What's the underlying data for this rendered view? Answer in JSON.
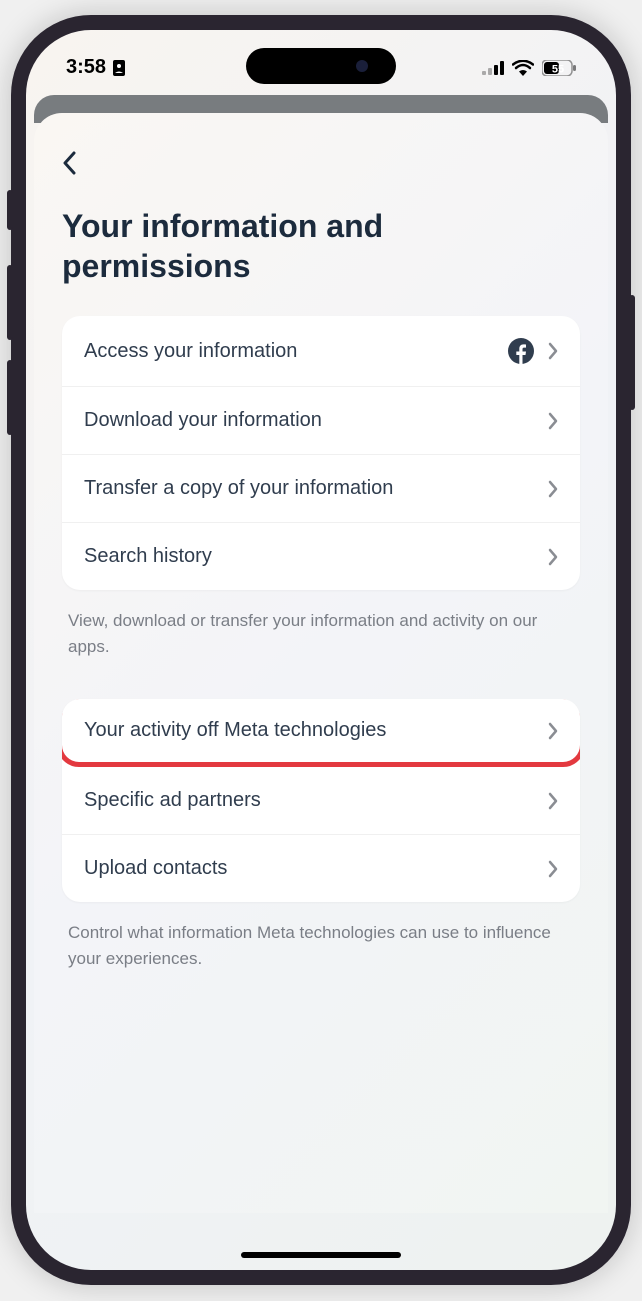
{
  "statusBar": {
    "time": "3:58",
    "battery": "55"
  },
  "page": {
    "title": "Your information and permissions"
  },
  "section1": {
    "items": [
      {
        "label": "Access your information",
        "hasFbIcon": true
      },
      {
        "label": "Download your information"
      },
      {
        "label": "Transfer a copy of your information"
      },
      {
        "label": "Search history"
      }
    ],
    "description": "View, download or transfer your information and activity on our apps."
  },
  "section2": {
    "items": [
      {
        "label": "Your activity off Meta technologies",
        "highlighted": true
      },
      {
        "label": "Specific ad partners"
      },
      {
        "label": "Upload contacts"
      }
    ],
    "description": "Control what information Meta technologies can use to influence your experiences."
  }
}
